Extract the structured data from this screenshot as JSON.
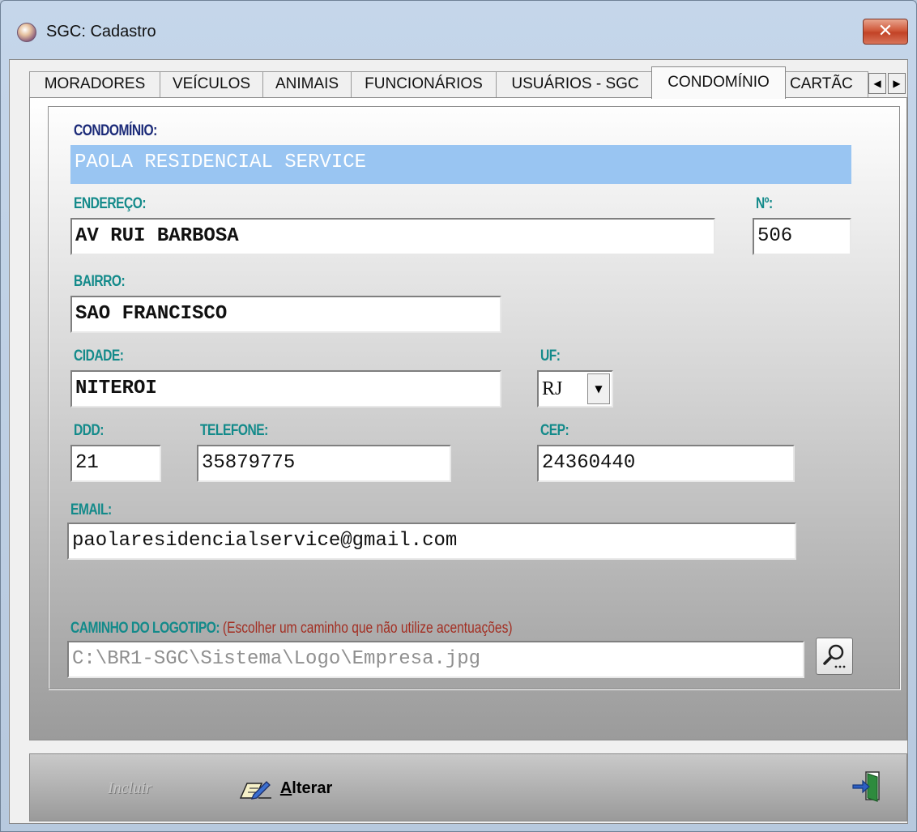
{
  "window": {
    "title": "SGC: Cadastro",
    "close_label": "✕"
  },
  "tabs": [
    {
      "label": "MORADORES",
      "active": false
    },
    {
      "label": "VEÍCULOS",
      "active": false
    },
    {
      "label": "ANIMAIS",
      "active": false
    },
    {
      "label": "FUNCIONÁRIOS",
      "active": false
    },
    {
      "label": "USUÁRIOS - SGC",
      "active": false
    },
    {
      "label": "CONDOMÍNIO",
      "active": true
    },
    {
      "label": "CARTÃC",
      "active": false
    }
  ],
  "tab_scroll": {
    "left": "◀",
    "right": "▶"
  },
  "form": {
    "condominio": {
      "label": "CONDOMÍNIO:",
      "value": "PAOLA RESIDENCIAL SERVICE"
    },
    "endereco": {
      "label": "ENDEREÇO:",
      "value": "AV RUI BARBOSA"
    },
    "numero": {
      "label": "Nº:",
      "value": "506"
    },
    "bairro": {
      "label": "BAIRRO:",
      "value": "SAO FRANCISCO"
    },
    "cidade": {
      "label": "CIDADE:",
      "value": "NITEROI"
    },
    "uf": {
      "label": "UF:",
      "value": "RJ",
      "arrow": "▼"
    },
    "ddd": {
      "label": "DDD:",
      "value": "21"
    },
    "telefone": {
      "label": "TELEFONE:",
      "value": "35879775"
    },
    "cep": {
      "label": "CEP:",
      "value": "24360440"
    },
    "email": {
      "label": "EMAIL:",
      "value": "paolaresidencialservice@gmail.com"
    },
    "logotipo": {
      "label": "CAMINHO DO LOGOTIPO:",
      "hint": "(Escolher um caminho que não utilize acentuações)",
      "value": "C:\\BR1-SGC\\Sistema\\Logo\\Empresa.jpg"
    }
  },
  "footer": {
    "incluir_label": "Incluir",
    "alterar_mnemonic": "A",
    "alterar_rest": "lterar"
  },
  "colors": {
    "navy_label": "#1b2a78",
    "teal_label": "#138a8a",
    "hint_red": "#a32e22",
    "selection": "#99c5f2",
    "close_red": "#c24326"
  }
}
